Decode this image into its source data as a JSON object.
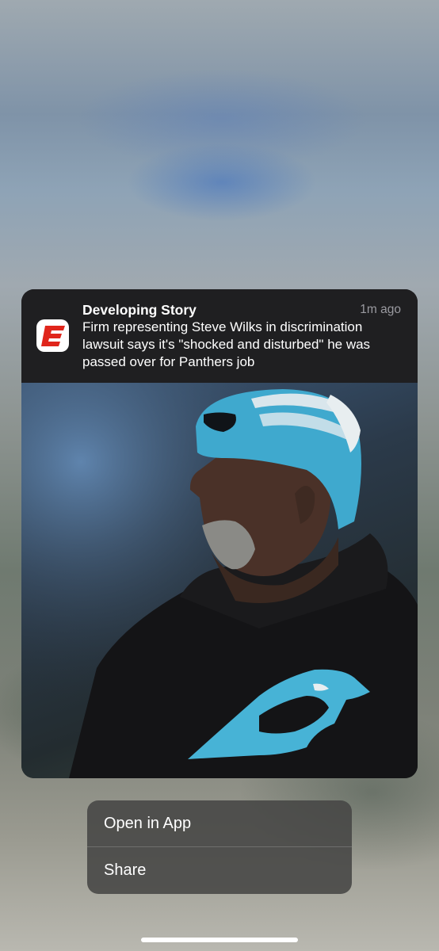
{
  "notification": {
    "title": "Developing Story",
    "time": "1m ago",
    "body": "Firm representing Steve Wilks in discrimination lawsuit says it's \"shocked and disturbed\" he was passed over for Panthers job",
    "app_icon": "espn-e-icon",
    "image": "photo of man in teal Panthers beanie and black Panthers hoodie"
  },
  "menu": {
    "items": [
      {
        "label": "Open in App"
      },
      {
        "label": "Share"
      }
    ]
  },
  "colors": {
    "accent_red": "#e0251b",
    "panthers_teal": "#47b3d6",
    "card_bg": "#1f1f21"
  }
}
